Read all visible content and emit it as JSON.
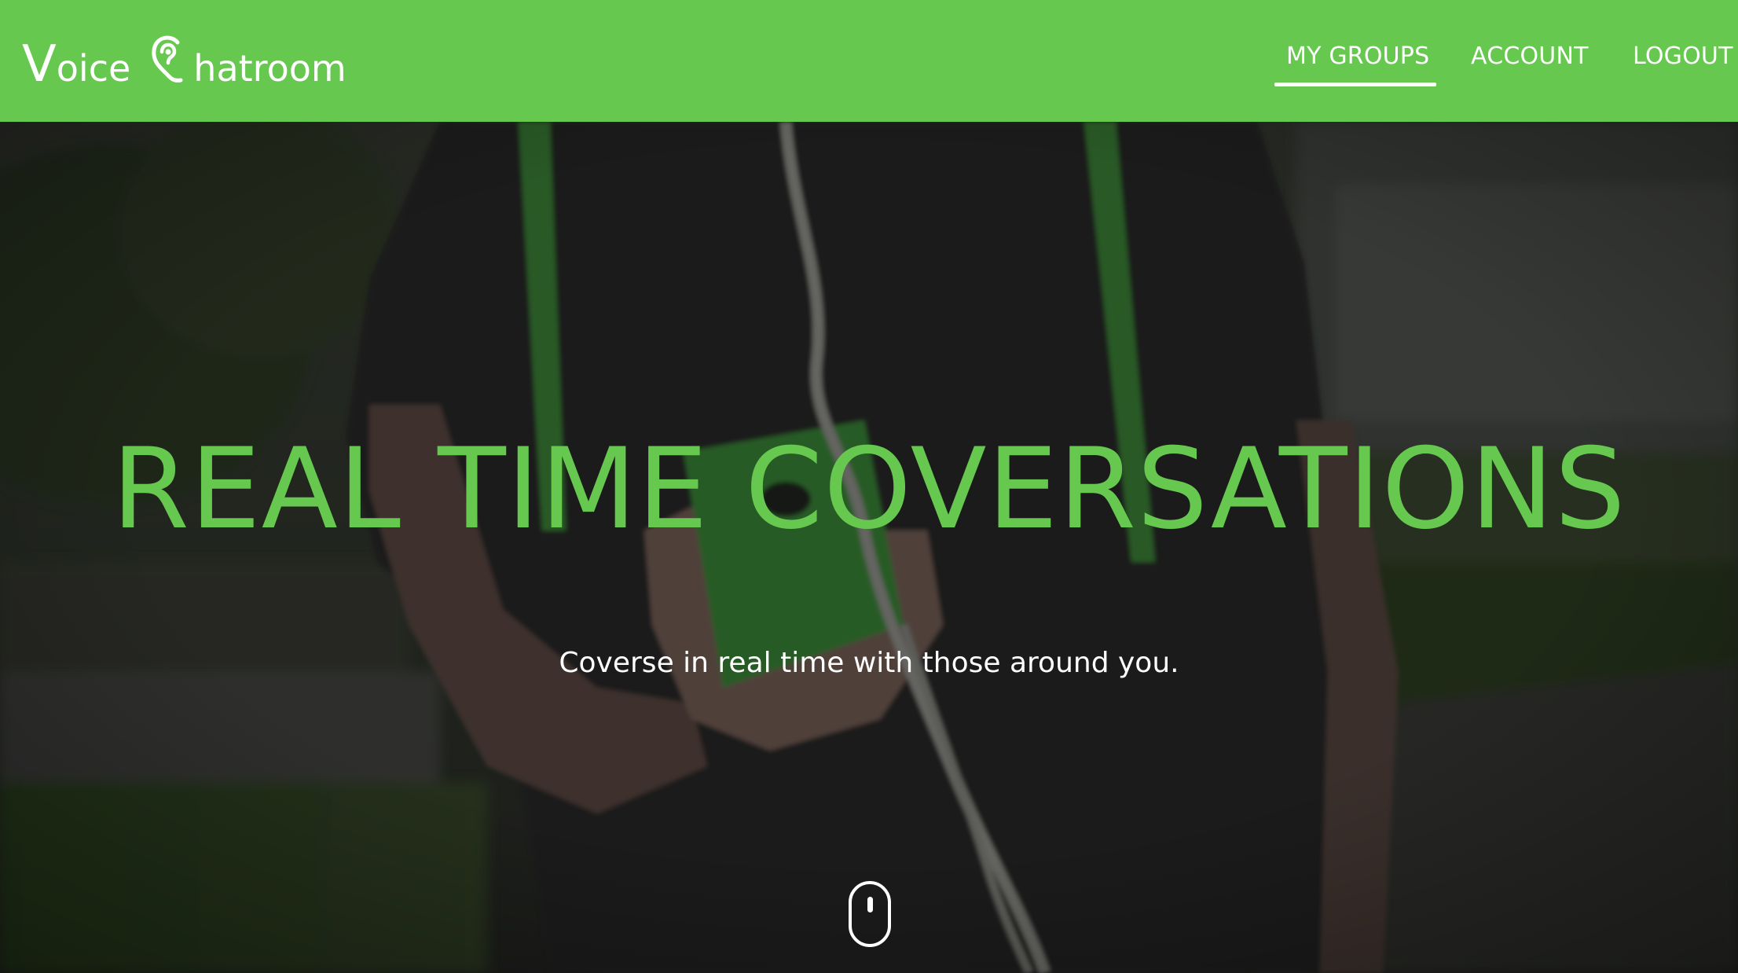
{
  "brand": {
    "name_part1_initial": "V",
    "name_part1_rest": "oice",
    "name_part2_rest": "hatroom",
    "logo_icon": "ear-c-icon"
  },
  "nav": {
    "items": [
      {
        "label": "MY GROUPS",
        "active": true
      },
      {
        "label": "ACCOUNT",
        "active": false
      },
      {
        "label": "LOGOUT",
        "active": false
      }
    ]
  },
  "hero": {
    "title": "REAL TIME COVERSATIONS",
    "subtitle": "Coverse in real time with those around you.",
    "scroll_icon": "mouse-scroll-icon",
    "background_description_icon": "person-holding-phone-photo"
  },
  "colors": {
    "brand_green": "#67c84f",
    "text_white": "#ffffff"
  }
}
